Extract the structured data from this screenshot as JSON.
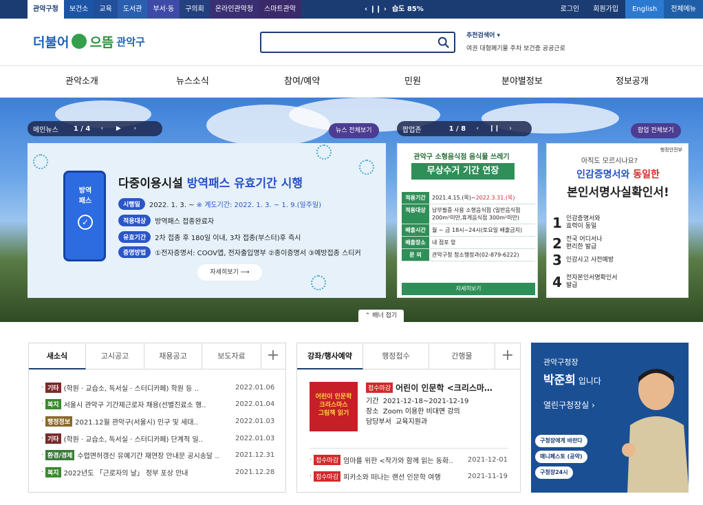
{
  "topbar": {
    "tabs": [
      "관악구청",
      "보건소",
      "교육",
      "도서관",
      "부서·동",
      "구의회",
      "온라인관악청",
      "스마트관악"
    ],
    "weather_ctl": "‹ ❙❙ ›",
    "weather": "습도 85%",
    "right": [
      "로그인",
      "회원가입",
      "English",
      "전체메뉴"
    ]
  },
  "logo": {
    "part1": "더불어",
    "part2": "으뜸",
    "part3": "관악구"
  },
  "search": {
    "value": "",
    "placeholder": ""
  },
  "recommend": {
    "label": "추천검색어 ▾",
    "words": "여권  대형폐기물  주차  보건증  공공근로"
  },
  "gnb": [
    "관악소개",
    "뉴스소식",
    "참여/예약",
    "민원",
    "분야별정보",
    "정보공개"
  ],
  "banner": {
    "main_news": {
      "label": "메인뉴스",
      "page": "1 / 4",
      "more": "뉴스 전체보기"
    },
    "popup": {
      "label": "팝업존",
      "page": "1 / 8",
      "more": "팝업 전체보기"
    },
    "fold": "⌃ 배너 접기",
    "card1": {
      "phone_label": "방역\n패스",
      "title_a": "다중이용시설 ",
      "title_b": "방역패스 유효기간 시행",
      "rows": [
        {
          "label": "시행일",
          "value_a": "2022. 1. 3. ~ ",
          "value_b": "※ 계도기간: 2022. 1. 3. ~ 1. 9.(일주일)"
        },
        {
          "label": "적용대상",
          "value_a": "방역패스 접종완료자",
          "value_b": ""
        },
        {
          "label": "유효기간",
          "value_a": "2차 접종 후 180일 이내, 3차 접종(부스터)후 즉시",
          "value_b": ""
        },
        {
          "label": "증명방법",
          "value_a": "①전자증명서: COOV앱, 전자출입명부 ②종이증명서 ③예방접종 스티커",
          "value_b": ""
        }
      ],
      "more": "자세히보기  ⟶"
    },
    "card2": {
      "head": "관악구 소형음식점 음식물 쓰레기",
      "head2": "무상수거 기간 연장",
      "rows": [
        {
          "th": "적용기간",
          "td_a": "2021.4.15.(목)~",
          "td_b": "2022.3.31.(목)"
        },
        {
          "th": "적용대상",
          "td_a": "남부필증 사용 소형음식점 (일반음식점 200m²미만,휴게음식점 300m²미만)",
          "td_b": ""
        },
        {
          "th": "배출시간",
          "td_a": "월 ~ 금 18시~24시(토요일 배출금지)",
          "td_b": ""
        },
        {
          "th": "배출장소",
          "td_a": "내 점포 앞",
          "td_b": ""
        },
        {
          "th": "문 의",
          "td_a": "관악구청 청소행정과(02-879-6222)",
          "td_b": ""
        }
      ],
      "more": "자세히보기"
    },
    "card3": {
      "small": "행정안전부",
      "q": "아직도 모르시나요?",
      "h1_a": "인감증명서와 ",
      "h1_b": "동일한",
      "h2": "본인서명사실확인서!",
      "items": [
        {
          "n": "1",
          "t": "인감증명서와\n효력이 동일"
        },
        {
          "n": "2",
          "t": "전국 어디서나\n편리한 발급"
        },
        {
          "n": "3",
          "t": "인감사고 사전예방"
        },
        {
          "n": "4",
          "t": "전자본인서명확인서\n발급"
        }
      ]
    }
  },
  "board1": {
    "tabs": [
      "새소식",
      "고시공고",
      "채용공고",
      "보도자료"
    ],
    "plus": "+",
    "items": [
      {
        "cat": "기타",
        "color": "#7a2a2a",
        "title": "(학원 · 교습소, 독서실 · 스터디카페) 학원 등 ..",
        "date": "2022.01.06"
      },
      {
        "cat": "복지",
        "color": "#3a8a2e",
        "title": "서울시 관악구 기간제근로자 채용(선별진료소 행..",
        "date": "2022.01.04"
      },
      {
        "cat": "행정정보",
        "color": "#8a6a2a",
        "title": "2021.12월 관악구(서울시) 인구 및 세대..",
        "date": "2022.01.03"
      },
      {
        "cat": "기타",
        "color": "#7a2a2a",
        "title": "(학원 · 교습소, 독서실 · 스터디카페) 단계적 일..",
        "date": "2022.01.03"
      },
      {
        "cat": "환경/경제",
        "color": "#3a7a3a",
        "title": "수렵면허갱신 유예기간 재연장 안내문 공시송달 ..",
        "date": "2021.12.31"
      },
      {
        "cat": "복지",
        "color": "#3a8a2e",
        "title": "2022년도 「근로자의 날」 정부 포상 안내",
        "date": "2021.12.28"
      }
    ]
  },
  "board2": {
    "tabs": [
      "강좌/행사예약",
      "행정접수",
      "간행물"
    ],
    "plus": "+",
    "event": {
      "thumb": "어린이 인문학\n크리스마스\n그림책 읽기",
      "badge": "접수마감",
      "title": "어린이 인문학 <크리스마…",
      "period_label": "기간",
      "period": "2021-12-18~2021-12-19",
      "place_label": "장소",
      "place": "Zoom 이용한 비대면 강의",
      "dept_label": "담당부서",
      "dept": "교육지원과"
    },
    "items": [
      {
        "cat": "접수마감",
        "title": "엄마를 위한 <작가와 함께 읽는 동화..",
        "date": "2021-12-01"
      },
      {
        "cat": "접수마감",
        "title": "피카소와 떠나는 랜선 인문학 여행",
        "date": "2021-11-19"
      }
    ]
  },
  "mayor": {
    "line1": "관악구청장",
    "name": "박준희",
    "suffix": " 입니다",
    "link": "열린구청장실 ›",
    "buttons": [
      "구청장에게 바란다",
      "매니페스토 (공약)",
      "구청장24시"
    ]
  }
}
